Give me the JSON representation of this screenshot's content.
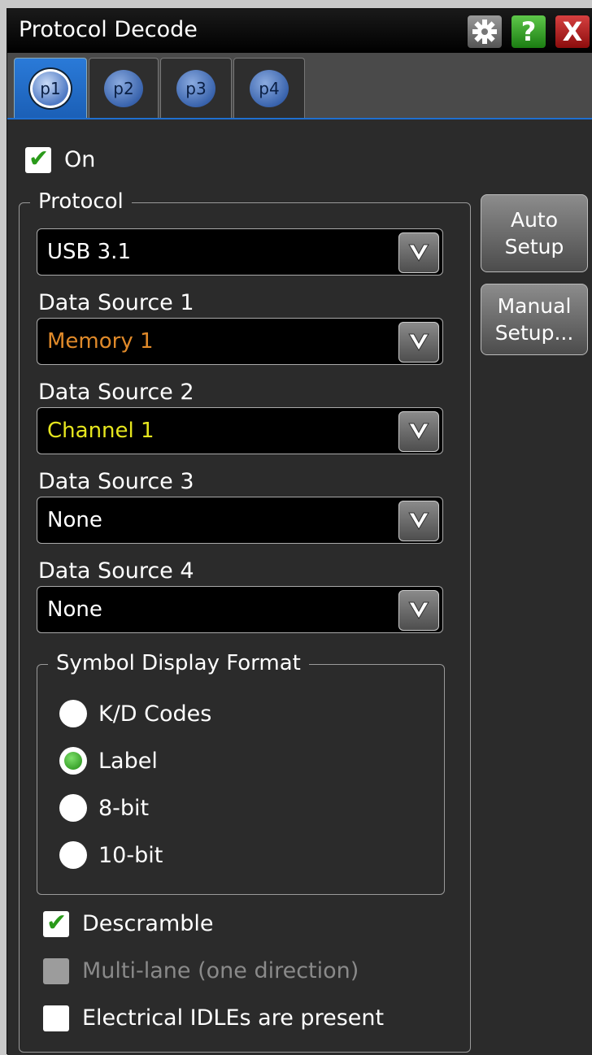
{
  "window": {
    "title": "Protocol Decode",
    "help_glyph": "?",
    "close_glyph": "X",
    "icons": [
      "gear-icon",
      "help-icon",
      "close-icon"
    ]
  },
  "tabs": [
    {
      "label": "p1",
      "active": true
    },
    {
      "label": "p2",
      "active": false
    },
    {
      "label": "p3",
      "active": false
    },
    {
      "label": "p4",
      "active": false
    }
  ],
  "on_checkbox": {
    "label": "On",
    "checked": true
  },
  "protocol": {
    "legend": "Protocol",
    "selected": "USB 3.1",
    "sources": [
      {
        "label": "Data Source 1",
        "value": "Memory 1",
        "color": "#e08a2a"
      },
      {
        "label": "Data Source 2",
        "value": "Channel 1",
        "color": "#e6e61e"
      },
      {
        "label": "Data Source 3",
        "value": "None",
        "color": "#ffffff"
      },
      {
        "label": "Data Source 4",
        "value": "None",
        "color": "#ffffff"
      }
    ]
  },
  "side_buttons": {
    "auto_setup": [
      "Auto",
      "Setup"
    ],
    "manual_setup": [
      "Manual",
      "Setup..."
    ]
  },
  "symbol_format": {
    "legend": "Symbol Display Format",
    "options": [
      {
        "label": "K/D Codes",
        "selected": false
      },
      {
        "label": "Label",
        "selected": true
      },
      {
        "label": "8-bit",
        "selected": false
      },
      {
        "label": "10-bit",
        "selected": false
      }
    ]
  },
  "options": [
    {
      "label": "Descramble",
      "checked": true,
      "enabled": true
    },
    {
      "label": "Multi-lane (one direction)",
      "checked": false,
      "enabled": false
    },
    {
      "label": "Electrical IDLEs are present",
      "checked": false,
      "enabled": true
    }
  ],
  "colors": {
    "accent_tab": "#1f6fd0",
    "check_green": "#2a9a1a"
  }
}
